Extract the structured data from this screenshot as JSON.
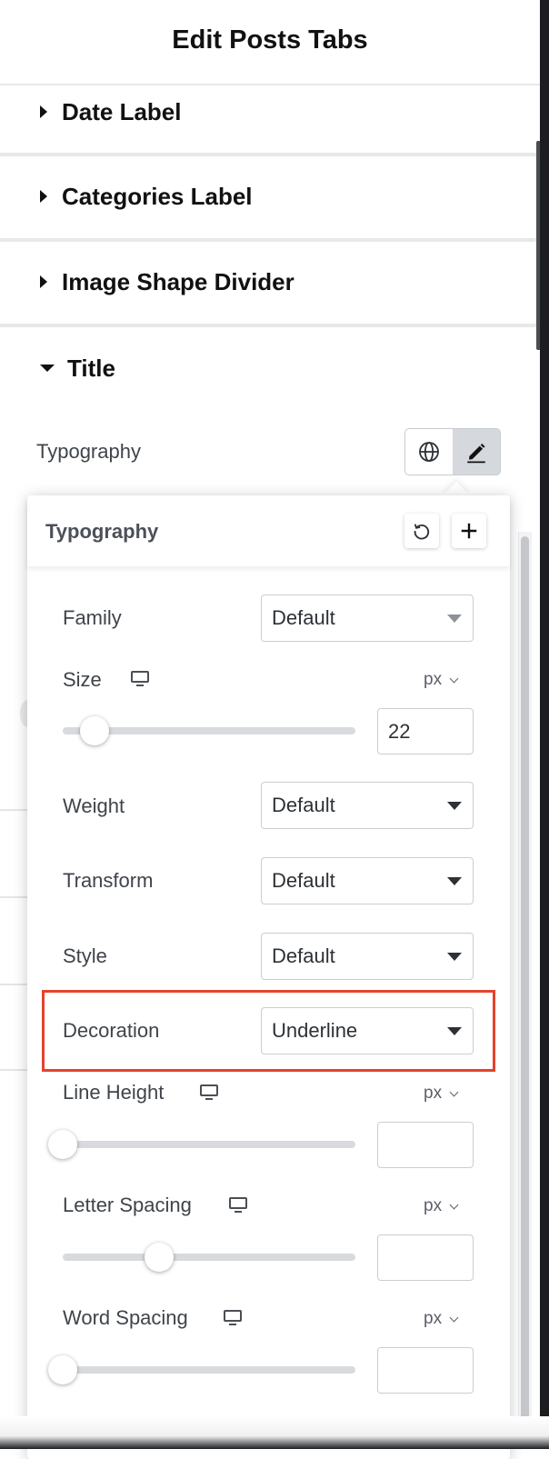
{
  "header": {
    "title": "Edit Posts Tabs"
  },
  "sections": [
    {
      "label": "Date Label",
      "expanded": false
    },
    {
      "label": "Categories Label",
      "expanded": false
    },
    {
      "label": "Image Shape Divider",
      "expanded": false
    },
    {
      "label": "Title",
      "expanded": true
    }
  ],
  "typography_row": {
    "label": "Typography",
    "global_icon": "globe-icon",
    "edit_icon": "pencil-icon"
  },
  "popover": {
    "title": "Typography",
    "reset_icon": "reset-icon",
    "add_icon": "plus-icon",
    "family": {
      "label": "Family",
      "value": "Default"
    },
    "size": {
      "label": "Size",
      "unit": "px",
      "value": "22",
      "slider_fraction": 0.11
    },
    "weight": {
      "label": "Weight",
      "value": "Default"
    },
    "transform": {
      "label": "Transform",
      "value": "Default"
    },
    "style": {
      "label": "Style",
      "value": "Default"
    },
    "decoration": {
      "label": "Decoration",
      "value": "Underline"
    },
    "line_height": {
      "label": "Line Height",
      "unit": "px",
      "value": "",
      "slider_fraction": 0.0
    },
    "letter_spacing": {
      "label": "Letter Spacing",
      "unit": "px",
      "value": "",
      "slider_fraction": 0.33
    },
    "word_spacing": {
      "label": "Word Spacing",
      "unit": "px",
      "value": "",
      "slider_fraction": 0.0
    }
  },
  "colors": {
    "highlight": "#e5432d",
    "text": "#3f444b",
    "active_button": "#d5d8dc"
  }
}
